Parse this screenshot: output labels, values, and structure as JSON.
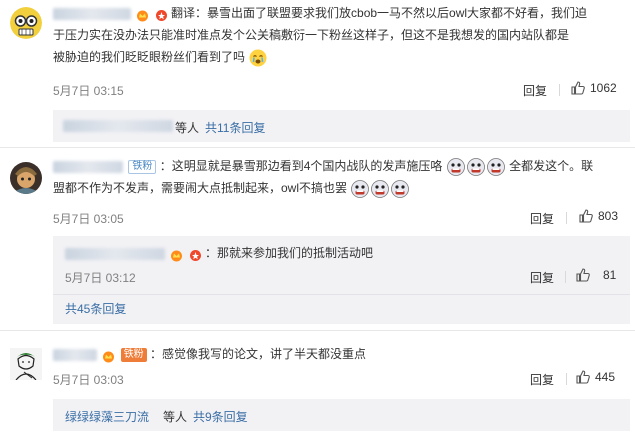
{
  "comments": [
    {
      "text_line1": "翻译：暴雪出面了联盟要求我们放cbob一马不然以后owl大家都不好看，我们迫",
      "text_line2": "于压力实在没办法只能准时准点发个公关稿敷衍一下粉丝这样子，但这不是我想发的国内站队都是",
      "text_line3": "被胁迫的我们眨眨眼粉丝们看到了吗",
      "time": "5月7日 03:15",
      "reply": "回复",
      "likes": "1062",
      "thread_suffix": "等人",
      "thread_link": "共11条回复"
    },
    {
      "badge": "铁粉",
      "text_line1": "：这明显就是暴雪那边看到4个国内战队的发声施压咯",
      "text_line1b": "全都发这个。联",
      "text_line2": "盟都不作为不发声，需要闹大点抵制起来，owl不搞也罢",
      "time": "5月7日 03:05",
      "reply": "回复",
      "likes": "803"
    },
    {
      "reply_text": "：那就来参加我们的抵制活动吧",
      "time": "5月7日 03:12",
      "reply": "回复",
      "likes": "81",
      "thread_link": "共45条回复"
    },
    {
      "badge": "铁粉",
      "text": "：感觉像我写的论文，讲了半天都没重点",
      "time": "5月7日 03:03",
      "reply": "回复",
      "likes": "445",
      "thread_user": "绿绿绿藻三刀流",
      "thread_suffix": "等人",
      "thread_link": "共9条回复"
    }
  ],
  "colors": {
    "link": "#3a6ea5",
    "meta": "#808080",
    "subbox": "#f2f2f5",
    "accent": "#f6a623"
  },
  "icons": [
    "thumbs-up-icon",
    "crown-icon",
    "crying-emoji-icon",
    "grimace-emoji-icon"
  ]
}
